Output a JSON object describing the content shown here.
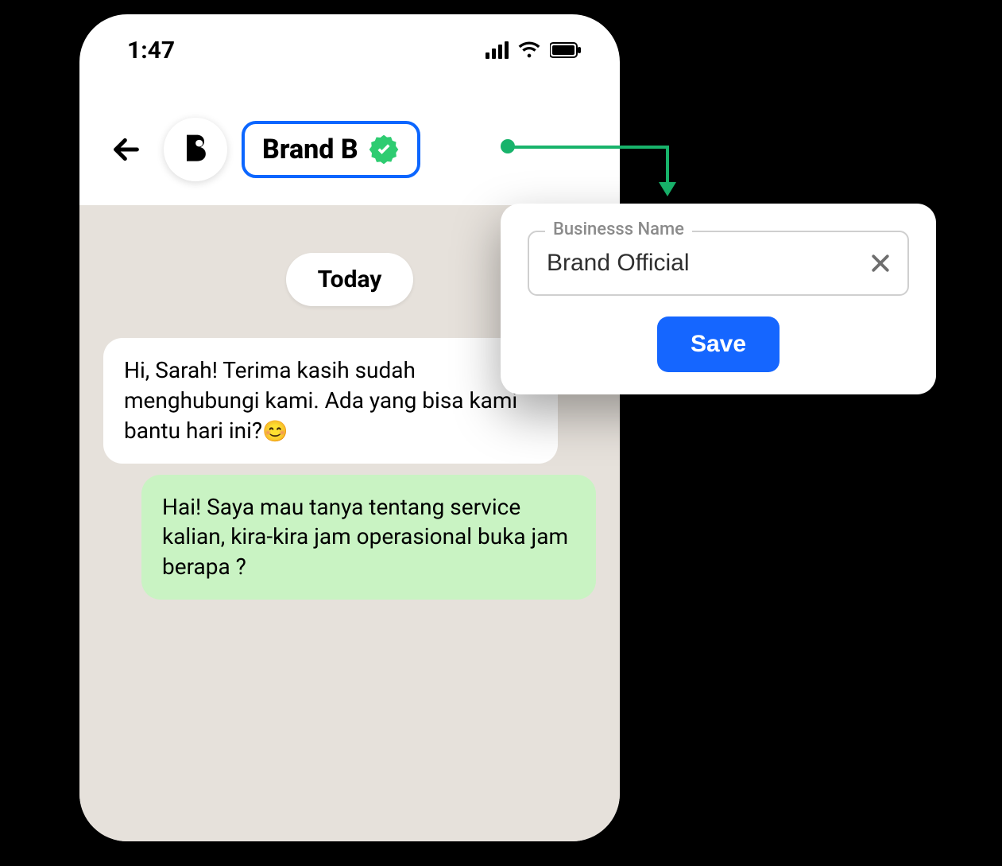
{
  "status": {
    "time": "1:47"
  },
  "chat": {
    "brand_name": "Brand B",
    "date_label": "Today",
    "messages": [
      {
        "from": "incoming",
        "text": "Hi, Sarah! Terima kasih sudah menghubungi kami. Ada yang bisa kami bantu hari ini?",
        "emoji": "😊"
      },
      {
        "from": "outgoing",
        "text": "Hai! Saya mau tanya tentang service kalian, kira-kira jam operasional buka jam berapa ?"
      }
    ]
  },
  "popover": {
    "field_label": "Businesss Name",
    "field_value": "Brand Official",
    "save_label": "Save"
  },
  "colors": {
    "accent_blue": "#1566ff",
    "verified_green": "#2ecc71",
    "connector_green": "#18b36b",
    "outgoing_bubble": "#c9f3c3",
    "chat_bg": "#e6e1db"
  }
}
